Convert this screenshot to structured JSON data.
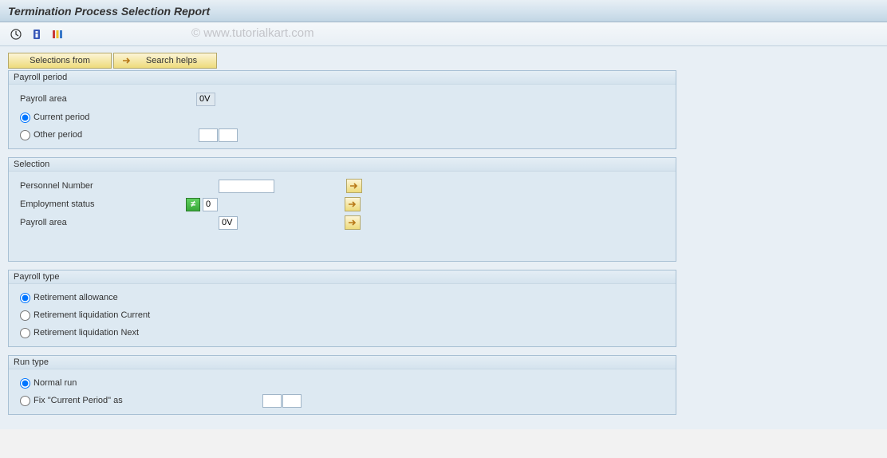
{
  "title": "Termination Process Selection Report",
  "watermark": "© www.tutorialkart.com",
  "buttons": {
    "selectionsFrom": "Selections from",
    "searchHelps": "Search helps"
  },
  "groups": {
    "payrollPeriod": {
      "title": "Payroll period",
      "payrollAreaLabel": "Payroll area",
      "payrollAreaValue": "0V",
      "currentPeriodLabel": "Current period",
      "otherPeriodLabel": "Other period"
    },
    "selection": {
      "title": "Selection",
      "personnelNumberLabel": "Personnel Number",
      "personnelNumberValue": "",
      "employmentStatusLabel": "Employment status",
      "employmentStatusValue": "0",
      "payrollAreaLabel": "Payroll area",
      "payrollAreaValue": "0V"
    },
    "payrollType": {
      "title": "Payroll type",
      "retirementAllowanceLabel": "Retirement allowance",
      "retirementLiquidationCurrentLabel": "Retirement liquidation Current",
      "retirementLiquidationNextLabel": "Retirement liquidation Next"
    },
    "runType": {
      "title": "Run type",
      "normalRunLabel": "Normal run",
      "fixCurrentPeriodLabel": "Fix \"Current Period\" as"
    }
  }
}
